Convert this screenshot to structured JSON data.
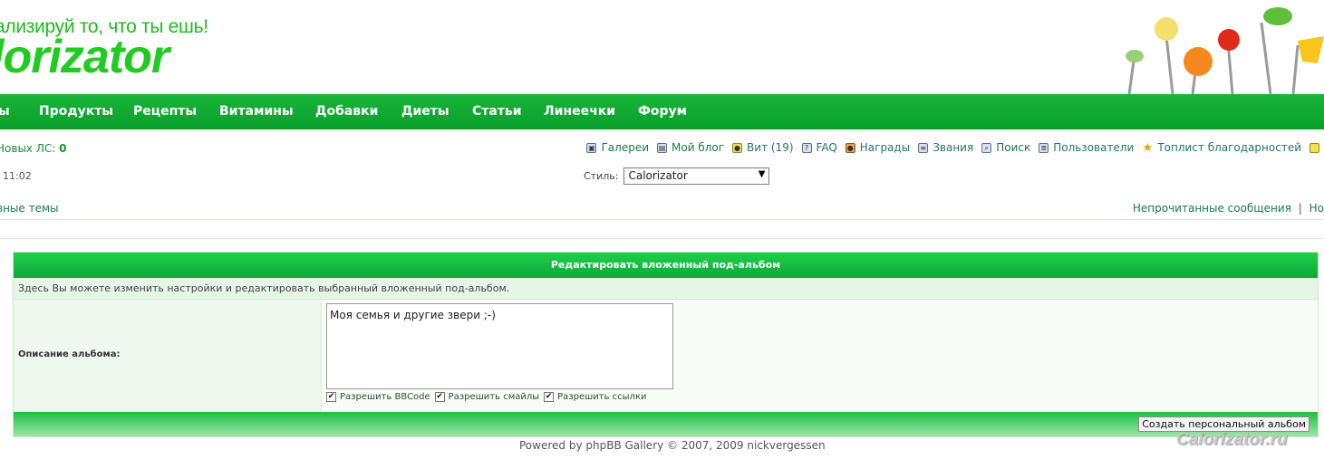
{
  "header": {
    "slogan": "ализируй то, что ты ешь!",
    "logo": "lorizator"
  },
  "nav": {
    "items": [
      "ы",
      "Продукты",
      "Рецепты",
      "Витамины",
      "Добавки",
      "Диеты",
      "Статьи",
      "Линеечки",
      "Форум"
    ]
  },
  "user": {
    "pm_label": "Новых ЛС:",
    "pm_count": "0",
    "time": ". 11:02"
  },
  "topnav": {
    "items": [
      {
        "label": "Галереи",
        "icon": "gallery-icon"
      },
      {
        "label": "Мой блог",
        "icon": "blog-icon"
      },
      {
        "label": "Вит (19)",
        "icon": "vit-icon"
      },
      {
        "label": "FAQ",
        "icon": "faq-icon"
      },
      {
        "label": "Награды",
        "icon": "awards-icon"
      },
      {
        "label": "Звания",
        "icon": "ranks-icon"
      },
      {
        "label": "Поиск",
        "icon": "search-icon"
      },
      {
        "label": "Пользователи",
        "icon": "users-icon"
      },
      {
        "label": "Топлист благодарностей",
        "icon": "star-icon"
      }
    ]
  },
  "style": {
    "label": "Стиль:",
    "selected": "Calorizator"
  },
  "links": {
    "new_topics": "вные темы",
    "unread": "Непрочитанные сообщения",
    "sep": "|",
    "next": "Но"
  },
  "panel": {
    "title": "Редактировать вложенный под-альбом",
    "description": "Здесь Вы можете изменить настройки и редактировать выбранный вложенный под-альбом.",
    "field_label": "Описание альбома:",
    "field_value": "Моя семья и другие звери ;-)",
    "checkboxes": [
      {
        "label": "Разрешить BBCode",
        "checked": true
      },
      {
        "label": "Разрешить смайлы",
        "checked": true
      },
      {
        "label": "Разрешить ссылки",
        "checked": true
      }
    ],
    "submit_label": "Создать персональный альбом"
  },
  "footer": {
    "text": "Powered by phpBB Gallery © 2007, 2009 nickvergessen"
  },
  "watermark": "Calorizator.ru",
  "colors": {
    "brand_green": "#08a02b",
    "logo_green": "#21cc21"
  }
}
